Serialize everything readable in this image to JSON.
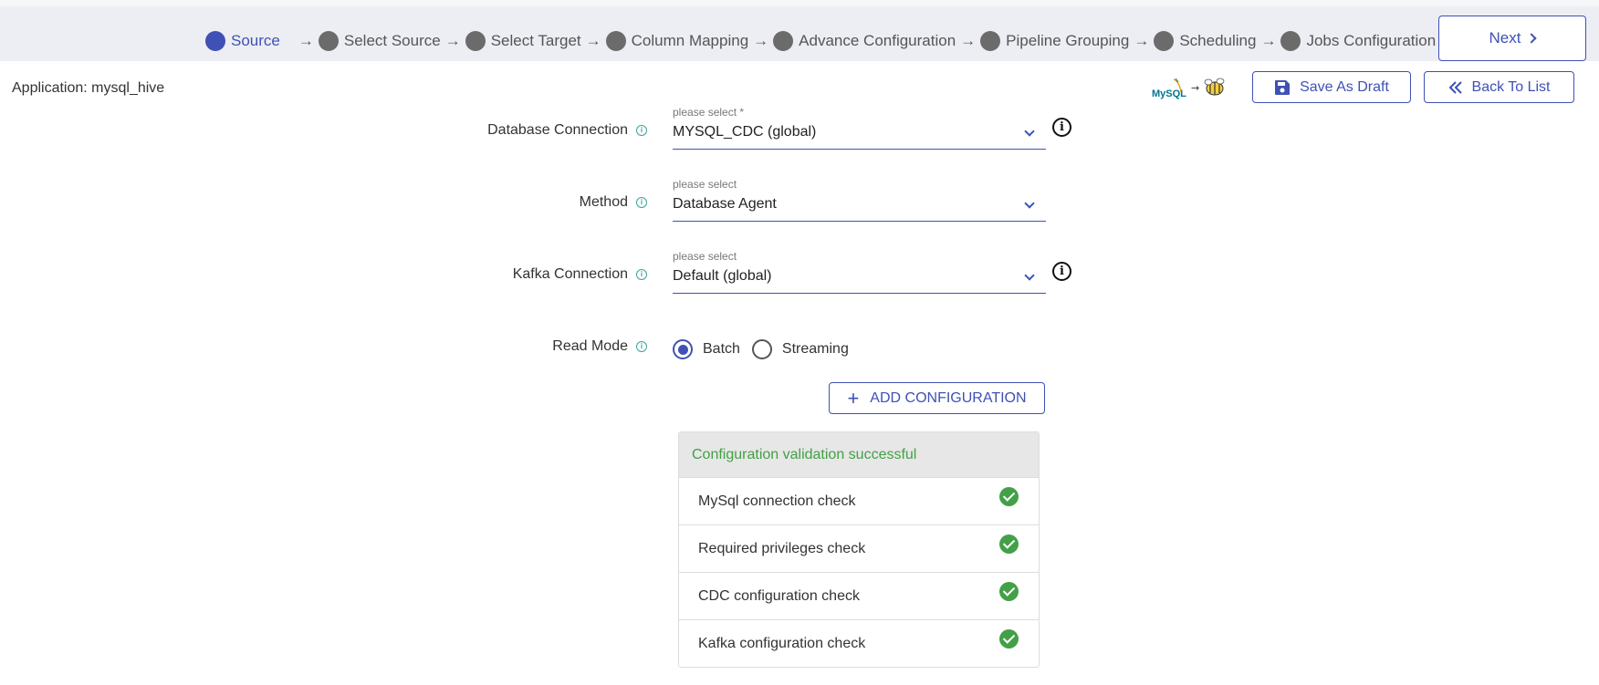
{
  "stepper": {
    "steps": [
      {
        "label": "Source",
        "active": true
      },
      {
        "label": "Select Source",
        "active": false
      },
      {
        "label": "Select Target",
        "active": false
      },
      {
        "label": "Column Mapping",
        "active": false
      },
      {
        "label": "Advance Configuration",
        "active": false
      },
      {
        "label": "Pipeline Grouping",
        "active": false
      },
      {
        "label": "Scheduling",
        "active": false
      },
      {
        "label": "Jobs Configuration",
        "active": false
      }
    ],
    "arrow": "→",
    "next_label": "Next"
  },
  "header": {
    "application_label": "Application: mysql_hive",
    "logo_source": "MySQL",
    "logo_arrow": "→",
    "logo_target_icon": "hive-bee-icon",
    "save_draft_label": "Save As Draft",
    "back_to_list_label": "Back To List"
  },
  "form": {
    "database_connection": {
      "label": "Database Connection",
      "placeholder": "please select *",
      "value": "MYSQL_CDC (global)"
    },
    "method": {
      "label": "Method",
      "placeholder": "please select",
      "value": "Database Agent"
    },
    "kafka_connection": {
      "label": "Kafka Connection",
      "placeholder": "please select",
      "value": "Default (global)"
    },
    "read_mode": {
      "label": "Read Mode",
      "options": [
        {
          "label": "Batch",
          "checked": true
        },
        {
          "label": "Streaming",
          "checked": false
        }
      ]
    },
    "add_configuration_label": "ADD CONFIGURATION"
  },
  "validation": {
    "title": "Configuration validation successful",
    "checks": [
      {
        "label": "MySql connection check",
        "status": "success"
      },
      {
        "label": "Required privileges check",
        "status": "success"
      },
      {
        "label": "CDC configuration check",
        "status": "success"
      },
      {
        "label": "Kafka configuration check",
        "status": "success"
      }
    ]
  },
  "colors": {
    "primary": "#3f51b5",
    "success": "#43a047",
    "inactive_step": "#6b6b6b",
    "topbar_bg": "#eceef4"
  }
}
